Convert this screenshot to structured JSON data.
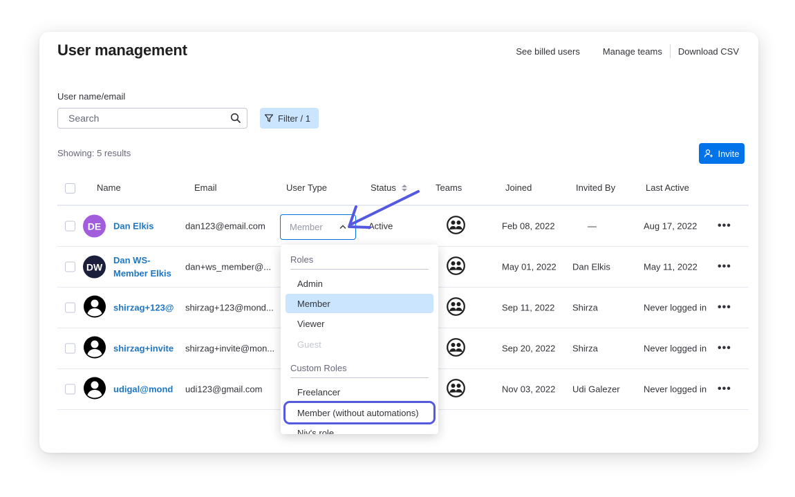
{
  "page": {
    "title": "User management",
    "links": [
      "See billed users",
      "Manage teams",
      "Download CSV"
    ]
  },
  "search": {
    "label": "User name/email",
    "placeholder": "Search"
  },
  "filter": {
    "label": "Filter / 1"
  },
  "showing": "Showing: 5 results",
  "invite": {
    "label": "Invite"
  },
  "columns": [
    "Name",
    "Email",
    "User Type",
    "Status",
    "Teams",
    "Joined",
    "Invited By",
    "Last Active"
  ],
  "users": [
    {
      "initials": "DE",
      "avatar_color": "#a25ddc",
      "name": "Dan Elkis",
      "email": "dan123@email.com",
      "status": "Active",
      "joined": "Feb 08, 2022",
      "invited_by": "—",
      "last_active": "Aug 17, 2022"
    },
    {
      "initials": "DW",
      "avatar_color": "#1c1f3b",
      "name": "Dan WS-",
      "name2": "Member Elkis",
      "email": "dan+ws_member@...",
      "joined": "May 01, 2022",
      "invited_by": "Dan Elkis",
      "last_active": "May 11, 2022"
    },
    {
      "initials": "",
      "avatar": "person-icon",
      "name": "shirzag+123@",
      "email": "shirzag+123@mond...",
      "joined": "Sep 11, 2022",
      "invited_by": "Shirza",
      "last_active": "Never logged in"
    },
    {
      "initials": "",
      "avatar": "person-icon",
      "name": "shirzag+invite",
      "email": "shirzag+invite@mon...",
      "joined": "Sep 20, 2022",
      "invited_by": "Shirza",
      "last_active": "Never logged in"
    },
    {
      "initials": "",
      "avatar": "person-icon",
      "name": "udigal@mond",
      "email": "udi123@gmail.com",
      "joined": "Nov 03, 2022",
      "invited_by": "Udi Galezer",
      "last_active": "Never logged in"
    }
  ],
  "user_type_select": {
    "value": "Member"
  },
  "dropdown": {
    "group_roles": "Roles",
    "roles": [
      "Admin",
      "Member",
      "Viewer",
      "Guest"
    ],
    "group_custom": "Custom Roles",
    "custom_roles": [
      "Freelancer",
      "Member (without automations)",
      "Niv's role"
    ]
  },
  "colors": {
    "accent": "#0073ea",
    "link": "#1f76c2",
    "selected": "#cce5ff",
    "highlight": "#5559df"
  },
  "icons": [
    "search-icon",
    "filter-icon",
    "add-user-icon",
    "sort-icon",
    "team-icon",
    "chevron-up-icon",
    "more-icon",
    "arrow-annotation"
  ]
}
